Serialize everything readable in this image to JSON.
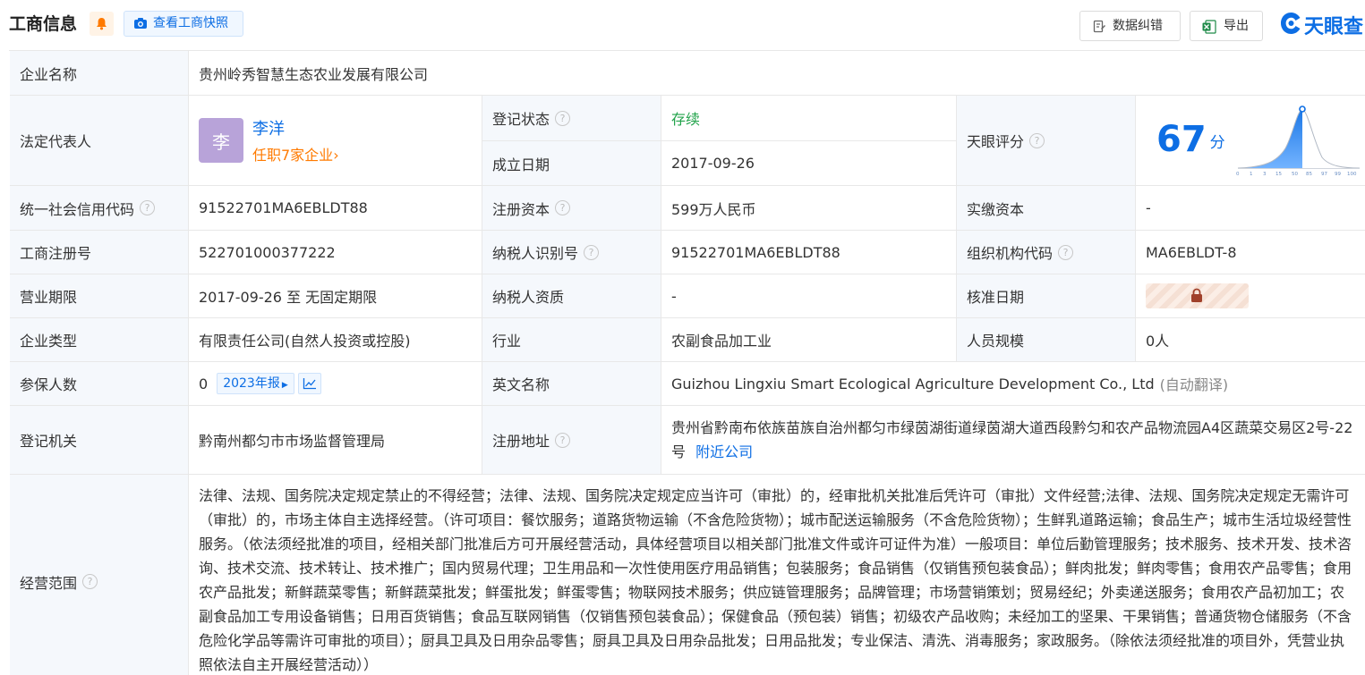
{
  "header": {
    "title": "工商信息",
    "snapshot_label": "查看工商快照",
    "correct_label": "数据纠错",
    "export_label": "导出",
    "brand": "天眼查"
  },
  "company": {
    "name_label": "企业名称",
    "name": "贵州岭秀智慧生态农业发展有限公司",
    "rep_label": "法定代表人",
    "rep_avatar": "李",
    "rep_name": "李洋",
    "rep_sub": "任职7家企业",
    "status_label": "登记状态",
    "status": "存续",
    "founded_label": "成立日期",
    "founded": "2017-09-26",
    "score_label": "天眼评分",
    "score": "67",
    "score_unit": "分",
    "score_axis": [
      "0",
      "1",
      "3",
      "15",
      "50",
      "85",
      "97",
      "99",
      "100"
    ],
    "credit_label": "统一社会信用代码",
    "credit_code": "91522701MA6EBLDT88",
    "capital_label": "注册资本",
    "capital": "599万人民币",
    "paid_label": "实缴资本",
    "paid": "-",
    "reg_no_label": "工商注册号",
    "reg_no": "522701000377222",
    "taxpayer_id_label": "纳税人识别号",
    "taxpayer_id": "91522701MA6EBLDT88",
    "org_code_label": "组织机构代码",
    "org_code": "MA6EBLDT-8",
    "term_label": "营业期限",
    "term": "2017-09-26 至 无固定期限",
    "taxpayer_qual_label": "纳税人资质",
    "taxpayer_qual": "-",
    "approve_label": "核准日期",
    "type_label": "企业类型",
    "type": "有限责任公司(自然人投资或控股)",
    "industry_label": "行业",
    "industry": "农副食品加工业",
    "staff_label": "人员规模",
    "staff": "0人",
    "insured_label": "参保人数",
    "insured": "0",
    "report_tag": "2023年报",
    "en_name_label": "英文名称",
    "en_name": "Guizhou Lingxiu Smart Ecological Agriculture Development Co., Ltd",
    "en_name_note": "(自动翻译)",
    "authority_label": "登记机关",
    "authority": "黔南州都匀市市场监督管理局",
    "address_label": "注册地址",
    "address": "贵州省黔南布依族苗族自治州都匀市绿茵湖街道绿茵湖大道西段黔匀和农产品物流园A4区蔬菜交易区2号-22号",
    "nearby_label": "附近公司",
    "scope_label": "经营范围",
    "scope": "法律、法规、国务院决定规定禁止的不得经营；法律、法规、国务院决定规定应当许可（审批）的，经审批机关批准后凭许可（审批）文件经营;法律、法规、国务院决定规定无需许可（审批）的，市场主体自主选择经营。（许可项目：餐饮服务；道路货物运输（不含危险货物）；城市配送运输服务（不含危险货物）；生鲜乳道路运输；食品生产；城市生活垃圾经营性服务。（依法须经批准的项目，经相关部门批准后方可开展经营活动，具体经营项目以相关部门批准文件或许可证件为准）一般项目：单位后勤管理服务；技术服务、技术开发、技术咨询、技术交流、技术转让、技术推广；国内贸易代理；卫生用品和一次性使用医疗用品销售；包装服务；食品销售（仅销售预包装食品）；鲜肉批发；鲜肉零售；食用农产品零售；食用农产品批发；新鲜蔬菜零售；新鲜蔬菜批发；鲜蛋批发；鲜蛋零售；物联网技术服务；供应链管理服务；品牌管理；市场营销策划；贸易经纪；外卖递送服务；食用农产品初加工；农副食品加工专用设备销售；日用百货销售；食品互联网销售（仅销售预包装食品）；保健食品（预包装）销售；初级农产品收购；未经加工的坚果、干果销售；普通货物仓储服务（不含危险化学品等需许可审批的项目）；厨具卫具及日用杂品零售；厨具卫具及日用杂品批发；日用品批发；专业保洁、清洗、消毒服务；家政服务。（除依法须经批准的项目外，凭营业执照依法自主开展经营活动））"
  },
  "colors": {
    "accent": "#0d6ee4",
    "label_bg": "#f5f8fc",
    "status_green": "#21a34a",
    "orange": "#ff7a00"
  }
}
